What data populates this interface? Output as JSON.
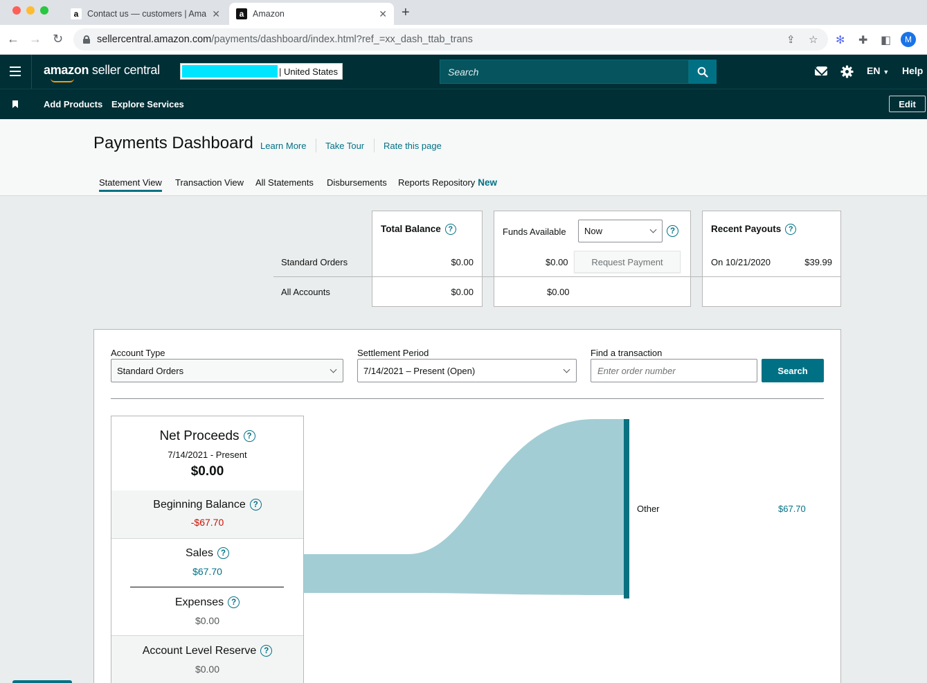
{
  "browser": {
    "tabs": [
      {
        "title": "Contact us — customers | Ama",
        "favicon": "a"
      },
      {
        "title": "Amazon",
        "favicon": "a"
      }
    ],
    "url_host": "sellercentral.amazon.com",
    "url_path": "/payments/dashboard/index.html?ref_=xx_dash_ttab_trans",
    "profile_initial": "M"
  },
  "header": {
    "logo_brand": "amazon",
    "logo_product": "seller central",
    "account_region": "| United States",
    "search_placeholder": "Search",
    "language": "EN",
    "help": "Help"
  },
  "nav": {
    "items": [
      "Add Products",
      "Explore Services"
    ],
    "edit": "Edit"
  },
  "page": {
    "title": "Payments Dashboard",
    "links": [
      "Learn More",
      "Take Tour",
      "Rate this page"
    ],
    "tabs": [
      {
        "label": "Statement View",
        "active": true
      },
      {
        "label": "Transaction View"
      },
      {
        "label": "All Statements"
      },
      {
        "label": "Disbursements"
      },
      {
        "label": "Reports Repository",
        "badge": "New"
      }
    ]
  },
  "balances": {
    "row_labels": [
      "Standard Orders",
      "All Accounts"
    ],
    "total_balance": {
      "title": "Total Balance",
      "standard": "$0.00",
      "all": "$0.00"
    },
    "funds_available": {
      "title": "Funds Available",
      "period": "Now",
      "standard": "$0.00",
      "all": "$0.00",
      "request_button": "Request Payment"
    },
    "recent_payouts": {
      "title": "Recent Payouts",
      "date": "On 10/21/2020",
      "amount": "$39.99"
    }
  },
  "filters": {
    "account_type_label": "Account Type",
    "account_type_value": "Standard Orders",
    "settlement_label": "Settlement Period",
    "settlement_value": "7/14/2021 – Present (Open)",
    "find_label": "Find a transaction",
    "find_placeholder": "Enter order number",
    "search_button": "Search"
  },
  "proceeds": {
    "net_title": "Net Proceeds",
    "net_period": "7/14/2021 - Present",
    "net_amount": "$0.00",
    "beginning_title": "Beginning Balance",
    "beginning_amount": "-$67.70",
    "sales_title": "Sales",
    "sales_amount": "$67.70",
    "expenses_title": "Expenses",
    "expenses_amount": "$0.00",
    "reserve_title": "Account Level Reserve",
    "reserve_amount": "$0.00"
  },
  "flow": {
    "target_label": "Other",
    "target_amount": "$67.70"
  },
  "colors": {
    "header_bg": "#002f36",
    "accent": "#007185",
    "flow_fill": "#a3cdd4",
    "negative": "#cc1100"
  }
}
